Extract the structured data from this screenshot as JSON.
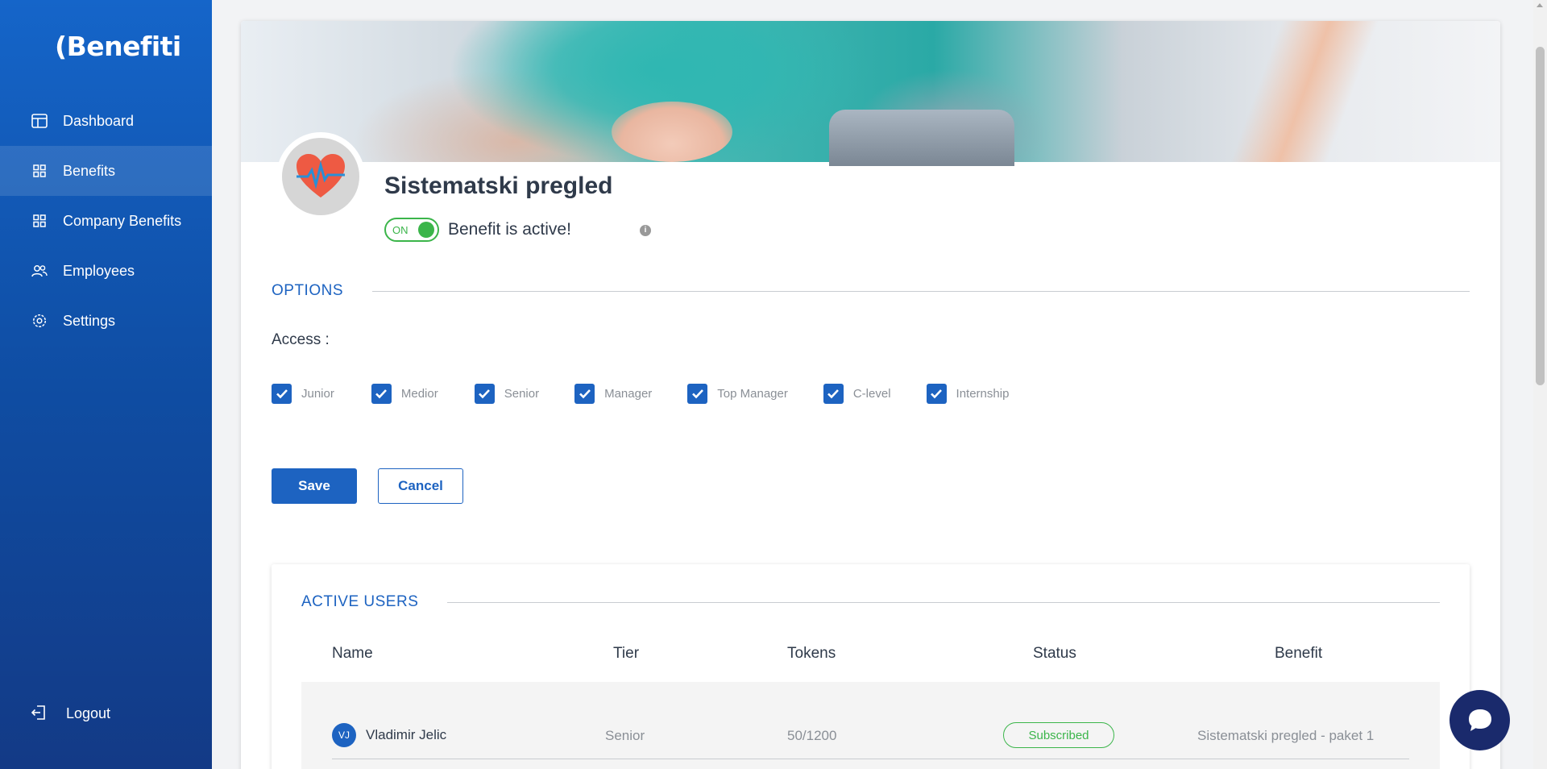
{
  "app": {
    "logo_text": "(Benefiti"
  },
  "sidebar": {
    "items": [
      {
        "label": "Dashboard",
        "icon": "dashboard-icon"
      },
      {
        "label": "Benefits",
        "icon": "grid-icon",
        "active": true
      },
      {
        "label": "Company Benefits",
        "icon": "grid-icon"
      },
      {
        "label": "Employees",
        "icon": "users-icon"
      },
      {
        "label": "Settings",
        "icon": "gear-icon"
      }
    ],
    "logout_label": "Logout"
  },
  "benefit": {
    "title": "Sistematski pregled",
    "toggle_label": "ON",
    "active_text": "Benefit is active!",
    "info_icon": "i"
  },
  "options": {
    "section_title": "OPTIONS",
    "access_label": "Access :",
    "levels": [
      "Junior",
      "Medior",
      "Senior",
      "Manager",
      "Top Manager",
      "C-level",
      "Internship"
    ]
  },
  "actions": {
    "save_label": "Save",
    "cancel_label": "Cancel"
  },
  "active_users": {
    "section_title": "ACTIVE USERS",
    "columns": {
      "name": "Name",
      "tier": "Tier",
      "tokens": "Tokens",
      "status": "Status",
      "benefit": "Benefit"
    },
    "rows": [
      {
        "initials": "VJ",
        "name": "Vladimir Jelic",
        "tier": "Senior",
        "tokens": "50/1200",
        "status": "Subscribed",
        "benefit": "Sistematski pregled - paket 1"
      }
    ]
  },
  "colors": {
    "accent": "#1d63c1",
    "success": "#3bb54a",
    "sidebar": "#1565c9"
  }
}
